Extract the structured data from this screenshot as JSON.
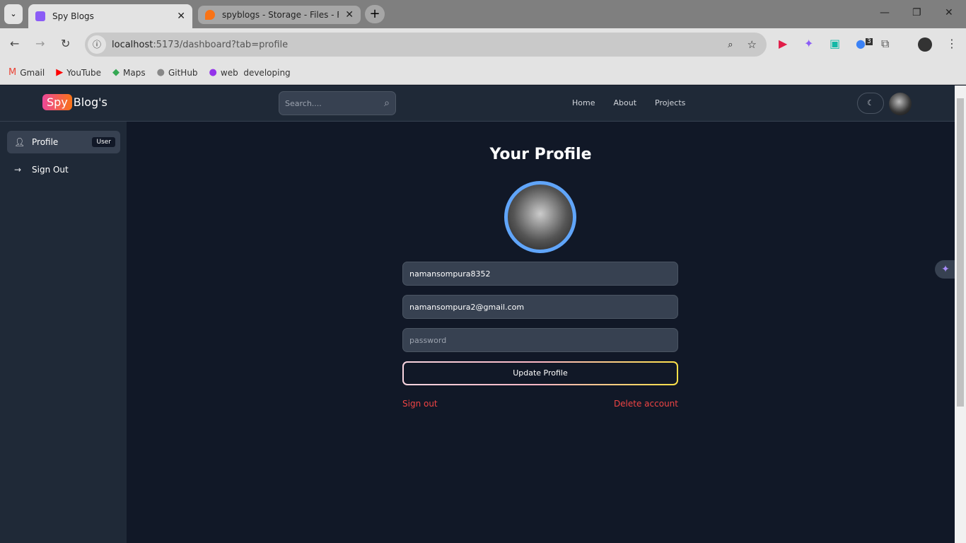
{
  "browser": {
    "tabs": [
      {
        "title": "Spy Blogs",
        "active": true
      },
      {
        "title": "spyblogs - Storage - Files - Fireb",
        "active": false
      }
    ],
    "url_host": "localhost",
    "url_path": ":5173/dashboard?tab=profile",
    "bookmarks": [
      {
        "label": "Gmail",
        "icon": "gmail-icon"
      },
      {
        "label": "YouTube",
        "icon": "youtube-icon"
      },
      {
        "label": "Maps",
        "icon": "maps-icon"
      },
      {
        "label": "GitHub",
        "icon": "github-icon"
      },
      {
        "label": "web  developing",
        "icon": "bookmark-icon"
      }
    ],
    "extension_badge": "3"
  },
  "header": {
    "logo_highlight": "Spy",
    "logo_rest": "Blog's",
    "search_placeholder": "Search....",
    "links": [
      "Home",
      "About",
      "Projects"
    ]
  },
  "sidebar": {
    "items": [
      {
        "label": "Profile",
        "badge": "User",
        "active": true
      },
      {
        "label": "Sign Out"
      }
    ]
  },
  "profile": {
    "title": "Your Profile",
    "username": "namansompura8352",
    "email": "namansompura2@gmail.com",
    "password_placeholder": "password",
    "update_label": "Update Profile",
    "sign_out": "Sign out",
    "delete_account": "Delete account"
  },
  "colors": {
    "accent_blue": "#60a5fa",
    "danger": "#ef4444",
    "bg": "#111827",
    "panel": "#1f2937"
  }
}
